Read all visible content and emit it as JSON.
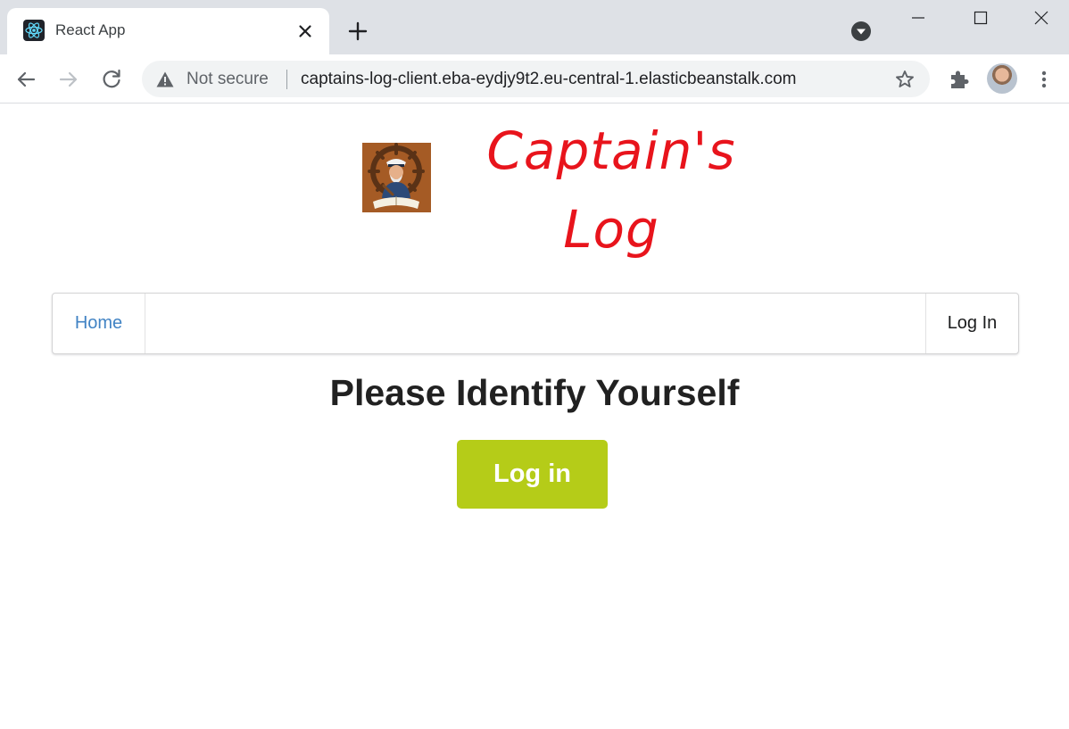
{
  "browser": {
    "tab": {
      "title": "React App",
      "favicon": "react-logo-icon"
    },
    "omnibox": {
      "security_label": "Not secure",
      "url": "captains-log-client.eba-eydjy9t2.eu-central-1.elasticbeanstalk.com"
    }
  },
  "page": {
    "logo": {
      "icon": "captain-at-ships-wheel-image",
      "title": "Captain's Log"
    },
    "navbar": {
      "home_label": "Home",
      "login_label": "Log In"
    },
    "heading": "Please Identify Yourself",
    "login_button_label": "Log in"
  },
  "colors": {
    "title_red": "#e8141c",
    "link_blue": "#4183c4",
    "button_olive": "#b5cc18"
  }
}
